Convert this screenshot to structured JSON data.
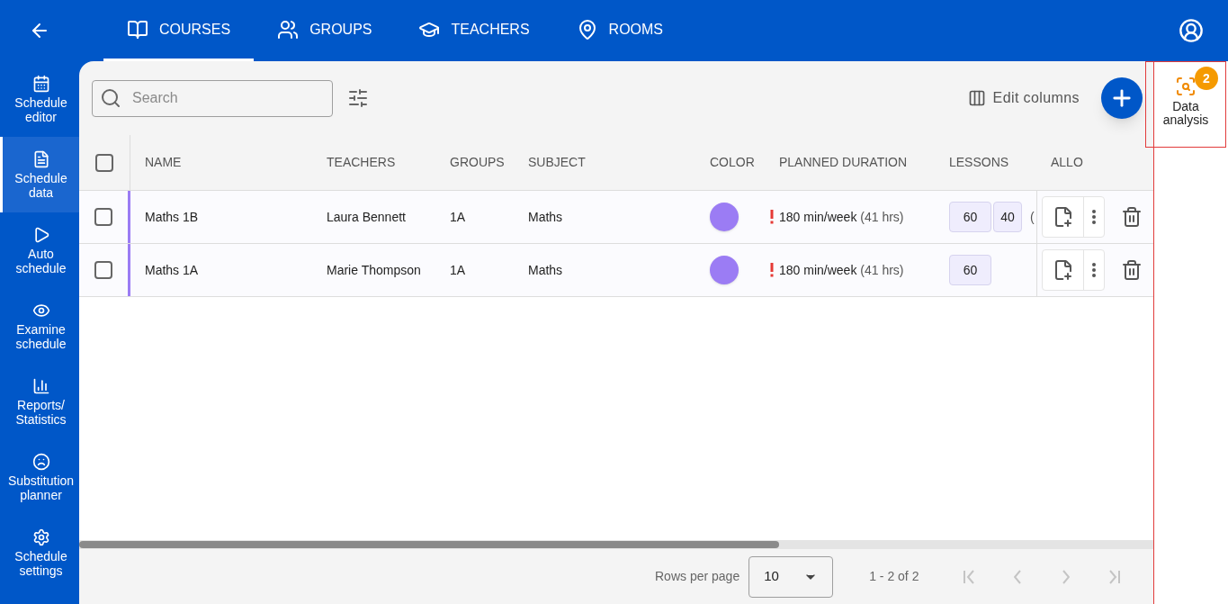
{
  "top_bar": {
    "tabs": [
      {
        "label": "COURSES",
        "selected": true
      },
      {
        "label": "GROUPS",
        "selected": false
      },
      {
        "label": "TEACHERS",
        "selected": false
      },
      {
        "label": "ROOMS",
        "selected": false
      }
    ]
  },
  "sidebar": {
    "items": [
      {
        "label": "Schedule editor",
        "selected": false
      },
      {
        "label": "Schedule data",
        "selected": true
      },
      {
        "label": "Auto schedule",
        "selected": false
      },
      {
        "label": "Examine schedule",
        "selected": false
      },
      {
        "label": "Reports/ Statistics",
        "selected": false
      },
      {
        "label": "Substitution planner",
        "selected": false
      },
      {
        "label": "Schedule settings",
        "selected": false
      }
    ]
  },
  "toolbar": {
    "search": {
      "placeholder": "Search"
    },
    "edit_columns": "Edit columns"
  },
  "table": {
    "select_all_checked": false,
    "columns": [
      "NAME",
      "TEACHERS",
      "GROUPS",
      "SUBJECT",
      "COLOR",
      "PLANNED DURATION",
      "LESSONS",
      "ALLO"
    ],
    "rows": [
      {
        "checked": false,
        "name": "Maths 1B",
        "teachers": "Laura Bennett",
        "groups": "1A",
        "subject": "Maths",
        "color": "#9b7cf4",
        "warning": true,
        "planned_duration": "180 min/week",
        "hours": "(41 hrs)",
        "lessons": [
          "60",
          "40"
        ],
        "lessons_more": "("
      },
      {
        "checked": false,
        "name": "Maths 1A",
        "teachers": "Marie Thompson",
        "groups": "1A",
        "subject": "Maths",
        "color": "#9b7cf4",
        "warning": true,
        "planned_duration": "180 min/week",
        "hours": "(41 hrs)",
        "lessons": [
          "60"
        ]
      }
    ]
  },
  "pagination": {
    "rows_per_page_label": "Rows per page",
    "rows_per_page": "10",
    "range": "1 - 2 of 2",
    "first_disabled": true,
    "previous_disabled": true,
    "next_disabled": true,
    "last_disabled": true
  },
  "data_analysis": {
    "label": "Data analysis",
    "badge": "2",
    "highlighted": true
  }
}
